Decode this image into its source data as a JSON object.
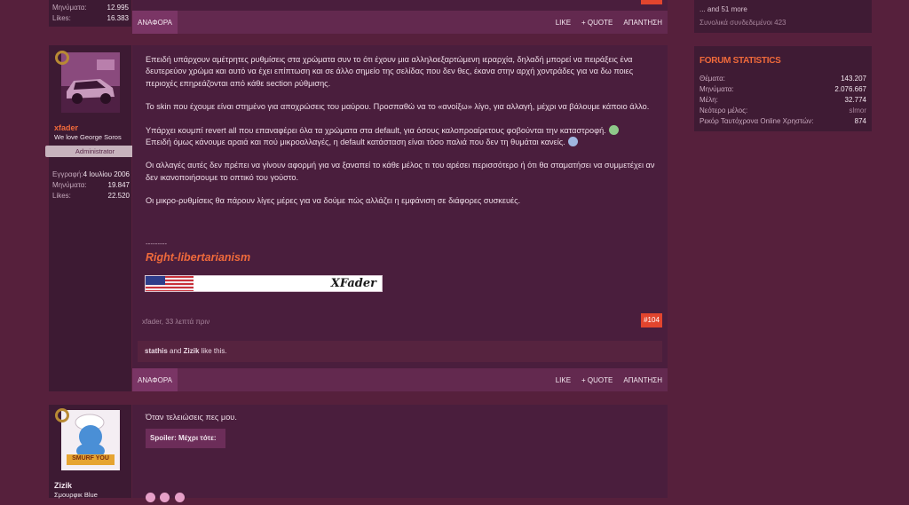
{
  "post_top": {
    "stats": [
      {
        "label": "Μηνύματα:",
        "value": "12.995"
      },
      {
        "label": "Likes:",
        "value": "16.383"
      }
    ],
    "reply_tab": "ΑΝΑΦΟΡΑ",
    "actions": [
      "LIKE",
      "+ QUOTE",
      "ΑΠΑΝΤΗΣΗ"
    ]
  },
  "post_main": {
    "username": "xfader",
    "user_title": "We love George Soros",
    "role": "Administrator",
    "stats": [
      {
        "label": "Εγγραφή:",
        "value": "4 Ιουλίου 2006"
      },
      {
        "label": "Μηνύματα:",
        "value": "19.847"
      },
      {
        "label": "Likes:",
        "value": "22.520"
      }
    ],
    "paragraphs": [
      "Επειδή υπάρχουν αμέτρητες ρυθμίσεις στα χρώματα συν το ότι έχουν μια αλληλοεξαρτώμενη ιεραρχία, δηλαδή μπορεί να πειράξεις ένα δευτερεύον χρώμα και αυτό να έχει επίπτωση και σε άλλο σημείο της σελίδας που δεν θες, έκανα στην αρχή χοντράδες για να δω ποιες περιοχές επηρεάζονται από κάθε section ρύθμισης.",
      "Το skin που έχουμε είναι στημένο για αποχρώσεις του μαύρου. Προσπαθώ να το «ανοίξω» λίγο, για αλλαγή, μέχρι να βάλουμε κάποιο άλλο.",
      "Υπάρχει κουμπί revert all που επαναφέρει όλα τα χρώματα στα default, για όσους καλοπροαίρετους φοβούνται την καταστροφή.",
      "Επειδή όμως κάνουμε αραιά και πού μικροαλλαγές, η default κατάσταση είναι τόσο παλιά που δεν τη θυμάται κανείς.",
      "Οι αλλαγές αυτές δεν πρέπει να γίνουν αφορμή για να ξαναπεί το κάθε μέλος τι του αρέσει περισσότερο ή ότι θα σταματήσει να συμμετέχει αν δεν ικανοποιήσουμε το οπτικό του γούστο.",
      "Οι μικρο-ρυθμίσεις θα πάρουν λίγες μέρες για να δούμε πώς αλλάζει η εμφάνιση σε διάφορες συσκευές."
    ],
    "sig_dashes": "---------",
    "sig_title": "Right-libertarianism",
    "sig_banner_text": "XFader",
    "meta": "xfader, 33 λεπτά πριν",
    "post_number": "#104",
    "likes_users": [
      "stathis",
      "Zizik"
    ],
    "likes_and": "and",
    "likes_suffix": "like this.",
    "reply_tab": "ΑΝΑΦΟΡΑ",
    "actions": [
      "LIKE",
      "+ QUOTE",
      "ΑΠΑΝΤΗΣΗ"
    ]
  },
  "post_next": {
    "username": "Zizik",
    "user_title": "Σμουρφικ Blue",
    "avatar_text": "SMURF YOU",
    "text": "Όταν τελειώσεις πες μου.",
    "spoiler": "Spoiler: Μέχρι τότε:"
  },
  "sidebar": {
    "online_more_prefix": "... and 51 more",
    "online_total": "Συνολικά συνδεδεμένοι 423",
    "stats_title": "FORUM STATISTICS",
    "stats": [
      {
        "label": "Θέματα:",
        "value": "143.207"
      },
      {
        "label": "Μηνύματα:",
        "value": "2.076.667"
      },
      {
        "label": "Μέλη:",
        "value": "32.774"
      },
      {
        "label": "Νεότερο μέλος:",
        "value": "slmor"
      },
      {
        "label": "Ρεκόρ Ταυτόχρονα Online Χρηστών:",
        "value": "874"
      }
    ]
  },
  "colors": {
    "accent": "#e2452e",
    "link": "#f06a3b",
    "role_bg": "#c7b3bd",
    "bar": "#63294f",
    "tab": "#7a3565"
  }
}
